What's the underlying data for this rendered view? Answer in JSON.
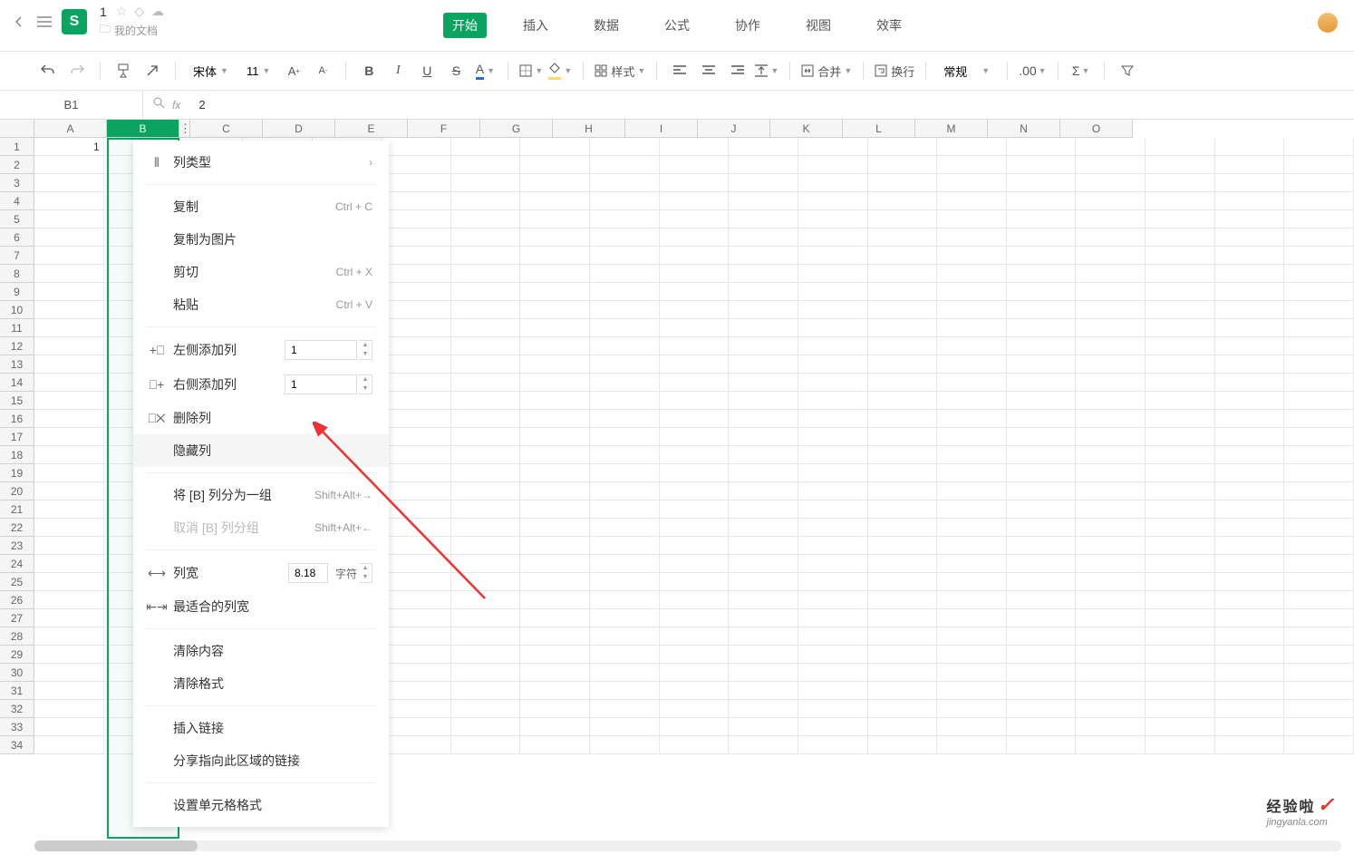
{
  "title": {
    "doc_name": "1",
    "doc_path": "我的文档"
  },
  "app_logo": "S",
  "tabs": {
    "start": "开始",
    "insert": "插入",
    "data": "数据",
    "formula": "公式",
    "collab": "协作",
    "view": "视图",
    "efficiency": "效率"
  },
  "toolbar": {
    "font_name": "宋体",
    "font_size": "11",
    "style_label": "样式",
    "merge_label": "合并",
    "wrap_label": "换行",
    "format_label": "常规"
  },
  "formula_bar": {
    "cell_ref": "B1",
    "value": "2"
  },
  "columns": [
    "A",
    "B",
    "C",
    "D",
    "E",
    "F",
    "G",
    "H",
    "I",
    "J",
    "K",
    "L",
    "M",
    "N",
    "O"
  ],
  "row_count": 34,
  "cell_A1": "1",
  "ctxmenu": {
    "col_type": "列类型",
    "copy": "复制",
    "copy_sc": "Ctrl + C",
    "copy_img": "复制为图片",
    "cut": "剪切",
    "cut_sc": "Ctrl + X",
    "paste": "粘贴",
    "paste_sc": "Ctrl + V",
    "add_left": "左侧添加列",
    "add_left_v": "1",
    "add_right": "右侧添加列",
    "add_right_v": "1",
    "del_col": "删除列",
    "hide_col": "隐藏列",
    "group": "将 [B] 列分为一组",
    "group_sc": "Shift+Alt+→",
    "ungroup": "取消 [B] 列分组",
    "ungroup_sc": "Shift+Alt+←",
    "width": "列宽",
    "width_v": "8.18",
    "width_unit": "字符",
    "fit_width": "最适合的列宽",
    "clear_content": "清除内容",
    "clear_format": "清除格式",
    "insert_link": "插入链接",
    "share_link": "分享指向此区域的链接",
    "cell_format": "设置单元格格式"
  },
  "watermark": {
    "main": "经验啦",
    "sub": "jingyanla.com"
  }
}
